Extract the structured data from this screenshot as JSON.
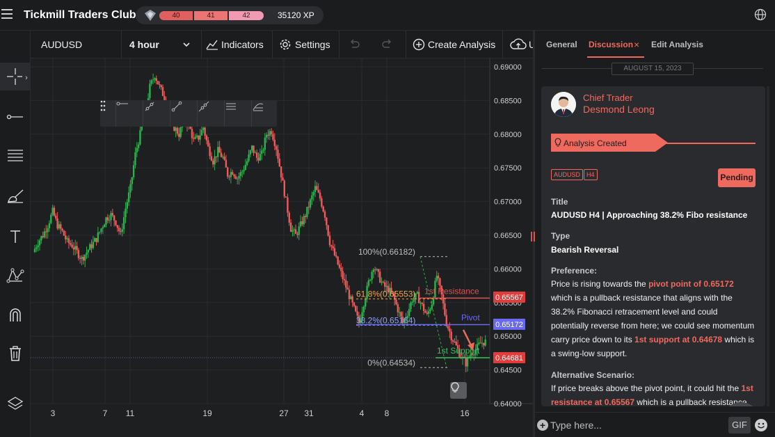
{
  "header": {
    "app_title": "Tickmill Traders Club",
    "levels": [
      "40",
      "41",
      "42"
    ],
    "xp": "35120 XP",
    "icons": [
      "menu-icon",
      "rank-badge-icon",
      "globe-icon"
    ]
  },
  "left_tools": [
    "crosshair-icon",
    "horizontal-ray-icon",
    "horizontal-lines-icon",
    "brush-icon",
    "text-icon",
    "pattern-icon",
    "magnet-icon",
    "trash-icon",
    "layers-icon"
  ],
  "chart_toolbar": {
    "symbol": "AUDUSD",
    "timeframe": "4 hour",
    "indicators": "Indicators",
    "settings": "Settings",
    "create_analysis": "Create Analysis",
    "publish_partial": "U"
  },
  "drawing_tools": [
    "horizontal-ray-icon",
    "trend-line-icon",
    "line-icon",
    "extended-line-icon",
    "parallel-lines-icon",
    "fib-icon"
  ],
  "chart_data": {
    "type": "candlestick",
    "symbol": "AUDUSD",
    "timeframe": "H4",
    "y_axis_ticks": [
      "0.69000",
      "0.68500",
      "0.68000",
      "0.67500",
      "0.67000",
      "0.66500",
      "0.66000",
      "0.65500",
      "0.65000",
      "0.64500",
      "0.64000"
    ],
    "ylim": [
      0.64,
      0.69
    ],
    "x_axis_ticks": [
      "3",
      "7",
      "11",
      "19",
      "27",
      "31",
      "4",
      "8",
      "16"
    ],
    "price_labels": [
      {
        "value": "0.65567",
        "color": "#e03c3c"
      },
      {
        "value": "0.65172",
        "color": "#6a6af0"
      },
      {
        "value": "0.64681",
        "color": "#e03c3c"
      }
    ],
    "levels": [
      {
        "name": "1st Resistance",
        "price": 0.65567,
        "color": "#e05252"
      },
      {
        "name": "Pivot",
        "price": 0.65172,
        "color": "#6a6af0"
      },
      {
        "name": "1st Support",
        "price": 0.64681,
        "color": "#34c759"
      }
    ],
    "fibonacci": [
      {
        "label": "100%(0.66182)",
        "price": 0.66182
      },
      {
        "label": "61.8%(0.65553)",
        "price": 0.65553
      },
      {
        "label": "38.2%(0.65164)",
        "price": 0.65164
      },
      {
        "label": "0%(0.64534)",
        "price": 0.64534
      }
    ],
    "close_path": [
      0.6625,
      0.664,
      0.665,
      0.6665,
      0.6685,
      0.6665,
      0.6655,
      0.664,
      0.6635,
      0.6625,
      0.6615,
      0.6625,
      0.6635,
      0.6645,
      0.666,
      0.6675,
      0.668,
      0.667,
      0.665,
      0.669,
      0.672,
      0.677,
      0.68,
      0.683,
      0.687,
      0.6888,
      0.687,
      0.6855,
      0.684,
      0.681,
      0.68,
      0.682,
      0.6815,
      0.679,
      0.6795,
      0.681,
      0.678,
      0.676,
      0.6775,
      0.6765,
      0.674,
      0.6745,
      0.6735,
      0.6745,
      0.676,
      0.678,
      0.6765,
      0.677,
      0.68,
      0.6805,
      0.678,
      0.674,
      0.67,
      0.666,
      0.665,
      0.6665,
      0.668,
      0.67,
      0.672,
      0.6705,
      0.668,
      0.664,
      0.662,
      0.66,
      0.658,
      0.656,
      0.654,
      0.652,
      0.655,
      0.658,
      0.6605,
      0.659,
      0.6575,
      0.657,
      0.656,
      0.654,
      0.652,
      0.6535,
      0.6555,
      0.656,
      0.6545,
      0.653,
      0.655,
      0.659,
      0.656,
      0.652,
      0.65,
      0.6485,
      0.647,
      0.646,
      0.6475,
      0.648,
      0.649,
      0.6492
    ]
  },
  "panel": {
    "tabs": [
      {
        "label": "General",
        "active": false
      },
      {
        "label": "Discussion",
        "active": true
      },
      {
        "label": "Edit Analysis",
        "active": false
      }
    ],
    "tab_close": "×",
    "date": "AUGUST 15, 2023",
    "author": {
      "role": "Chief Trader",
      "name": "Desmond Leong"
    },
    "status": "Analysis Created",
    "tags": [
      "AUDUSD",
      "H4"
    ],
    "pending": "Pending",
    "title_label": "Title",
    "title_value": "AUDUSD H4 | Approaching 38.2% Fibo resistance",
    "type_label": "Type",
    "type_value": "Bearish Reversal",
    "preference_label": "Preference:",
    "preference": {
      "p1": "Price is rising towards the ",
      "h1": "pivot point of 0.65172",
      "p2": " which is a pullback resistance that aligns with the 38.2% Fibonacci retracement level and could potentially reverse from here; we could see momentum carry price down to its ",
      "h2": "1st support at 0.64678",
      "p3": " which is a swing-low support."
    },
    "alt_label": "Alternative Scenario:",
    "alternative": {
      "p1": "If price breaks above the pivot point, it could hit the ",
      "h1": "1st resistance at 0.65567",
      "p2": " which is a pullback resistance"
    },
    "composer": {
      "placeholder": "Type here...",
      "gif": "GIF"
    }
  }
}
